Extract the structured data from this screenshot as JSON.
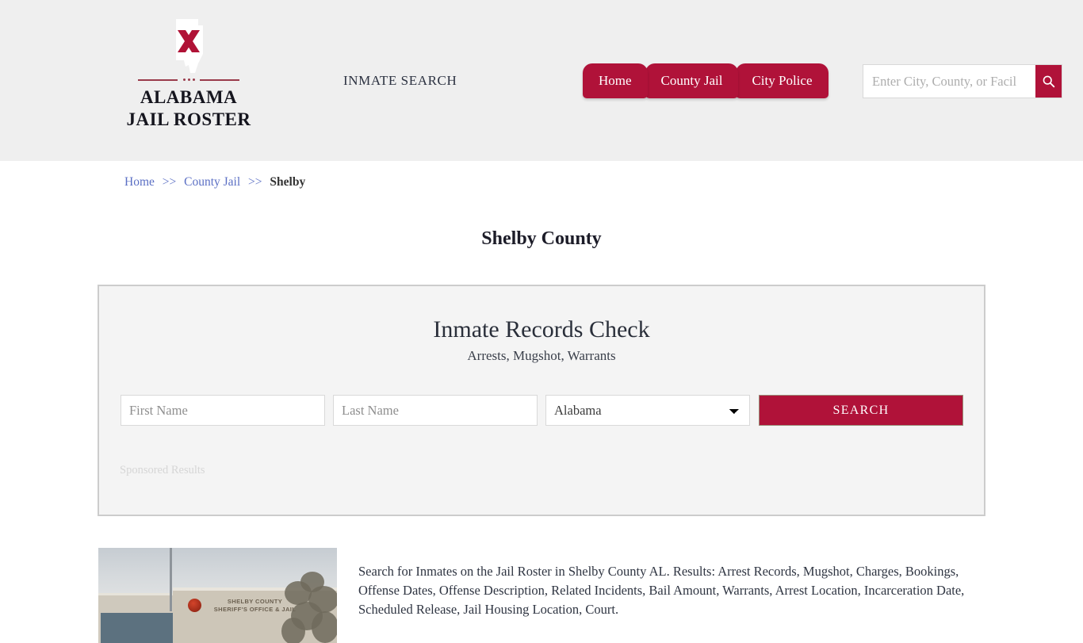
{
  "header": {
    "brand": {
      "line1": "ALABAMA",
      "line2": "JAIL ROSTER",
      "logo_icon": "alabama-state-flag-icon"
    },
    "tagline": "INMATE SEARCH",
    "nav": [
      {
        "label": "Home"
      },
      {
        "label": "County Jail"
      },
      {
        "label": "City Police"
      }
    ],
    "search": {
      "placeholder": "Enter City, County, or Facil",
      "value": "",
      "button_icon": "search-icon"
    },
    "background_color": "#efefef",
    "accent_color": "#b01239"
  },
  "breadcrumb": {
    "items": [
      {
        "label": "Home",
        "link": true
      },
      {
        "label": "County Jail",
        "link": true
      },
      {
        "label": "Shelby",
        "link": false
      }
    ],
    "separator": ">>"
  },
  "page": {
    "title": "Shelby County"
  },
  "sponsor_panel": {
    "title": "Inmate Records Check",
    "subtitle": "Arrests, Mugshot, Warrants",
    "form": {
      "first_name_placeholder": "First Name",
      "first_name_value": "",
      "last_name_placeholder": "Last Name",
      "last_name_value": "",
      "state_selected": "Alabama",
      "state_options": [
        "Alabama"
      ],
      "search_button_label": "SEARCH"
    },
    "sponsored_label": "Sponsored Results"
  },
  "content": {
    "photo_alt": "shelby-county-sheriffs-office-and-jail-photo",
    "photo_sign_line1": "SHELBY COUNTY",
    "photo_sign_line2": "SHERIFF'S OFFICE & JAIL",
    "description": "Search for Inmates on the Jail Roster in Shelby County AL. Results: Arrest Records, Mugshot, Charges, Bookings, Offense Dates, Offense Description, Related Incidents, Bail Amount, Warrants, Arrest Location, Incarceration Date, Scheduled Release, Jail Housing Location, Court."
  }
}
